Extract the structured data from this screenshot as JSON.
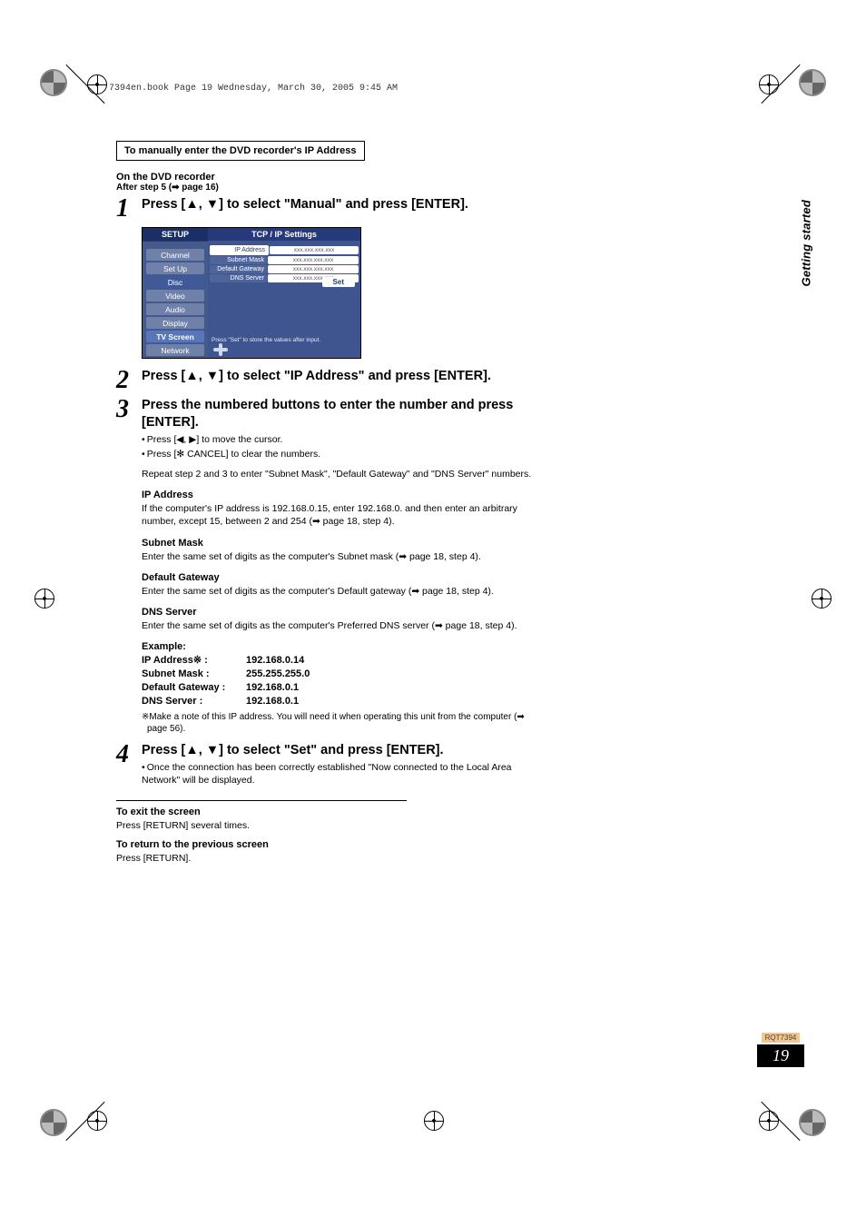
{
  "printHeader": "7394en.book  Page 19  Wednesday, March 30, 2005  9:45 AM",
  "boxedTitle": "To manually enter the DVD recorder's IP Address",
  "intro1": "On the DVD recorder",
  "intro2": "After step 5 (➡ page 16)",
  "steps": [
    {
      "n": "1",
      "title": "Press [▲, ▼] to select \"Manual\" and press [ENTER]."
    },
    {
      "n": "2",
      "title": "Press [▲, ▼] to select \"IP Address\" and press [ENTER]."
    },
    {
      "n": "3",
      "title": "Press the numbered buttons to enter the number and press [ENTER].",
      "subs": [
        "Press [◀, ▶] to move the cursor.",
        "Press [✻ CANCEL] to clear the numbers."
      ]
    },
    {
      "n": "4",
      "title": "Press [▲, ▼] to select \"Set\" and press [ENTER].",
      "post": "Once the connection has been correctly established \"Now connected to the Local Area Network\" will be displayed."
    }
  ],
  "repeatNote": "Repeat step 2 and 3 to enter \"Subnet Mask\", \"Default Gateway\" and \"DNS Server\" numbers.",
  "fields": [
    {
      "title": "IP Address",
      "body": "If the computer's IP address is 192.168.0.15, enter 192.168.0. and then enter an arbitrary number, except 15, between 2 and 254 (➡ page 18, step 4)."
    },
    {
      "title": "Subnet Mask",
      "body": "Enter the same set of digits as the computer's Subnet mask (➡ page 18, step 4)."
    },
    {
      "title": "Default Gateway",
      "body": "Enter the same set of digits as the computer's Default gateway (➡ page 18, step 4)."
    },
    {
      "title": "DNS Server",
      "body": "Enter the same set of digits as the computer's Preferred DNS server (➡ page 18, step 4)."
    }
  ],
  "exampleLabel": "Example:",
  "example": [
    {
      "k": "IP Address※ :",
      "v": "192.168.0.14"
    },
    {
      "k": "Subnet Mask :",
      "v": "255.255.255.0"
    },
    {
      "k": "Default Gateway :",
      "v": "192.168.0.1"
    },
    {
      "k": "DNS Server :",
      "v": "192.168.0.1"
    }
  ],
  "footnote": "※Make a note of this IP address. You will need it when operating this unit from the computer (➡ page 56).",
  "exit": {
    "title": "To exit the screen",
    "body": "Press [RETURN] several times."
  },
  "return": {
    "title": "To return to the previous screen",
    "body": "Press [RETURN]."
  },
  "panel": {
    "setupLabel": "SETUP",
    "rightTitle": "TCP / IP Settings",
    "menu": [
      "Channel",
      "Set Up",
      "Disc",
      "Video",
      "Audio",
      "Display",
      "TV Screen",
      "Network"
    ],
    "rows": [
      {
        "label": "IP Address",
        "val": "xxx.xxx.xxx.xxx",
        "sel": true
      },
      {
        "label": "Subnet Mask",
        "val": "xxx.xxx.xxx.xxx"
      },
      {
        "label": "Default Gateway",
        "val": "xxx.xxx.xxx.xxx"
      },
      {
        "label": "DNS Server",
        "val": "xxx.xxx.xxx.xxx"
      }
    ],
    "setBtn": "Set",
    "footer": "Press \"Set\" to store the values after input."
  },
  "sideTab": "Getting started",
  "docNumber": "RQT7394",
  "pageNumber": "19"
}
